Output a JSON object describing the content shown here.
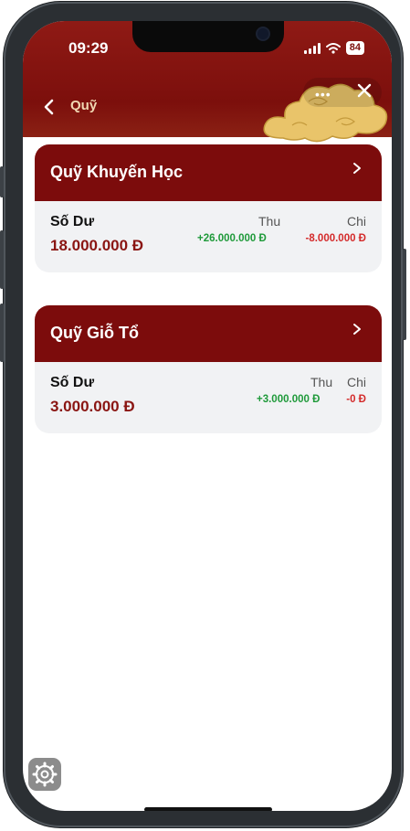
{
  "status_bar": {
    "time": "09:29",
    "battery": "84"
  },
  "header": {
    "title": "Quỹ"
  },
  "funds": [
    {
      "name": "Quỹ Khuyến Học",
      "balance_label": "Số Dư",
      "balance": "18.000.000 Đ",
      "income_label": "Thu",
      "income": "+26.000.000 Đ",
      "expense_label": "Chi",
      "expense": "-8.000.000 Đ"
    },
    {
      "name": "Quỹ Giỗ Tổ",
      "balance_label": "Số Dư",
      "balance": "3.000.000 Đ",
      "income_label": "Thu",
      "income": "+3.000.000 Đ",
      "expense_label": "Chi",
      "expense": "-0 Đ"
    }
  ],
  "icons": {
    "back": "chevron-left-icon",
    "more": "more-dots-icon",
    "close": "close-icon",
    "card_arrow": "chevron-right-icon",
    "floating": "gear-icon",
    "decoration": "cloud-decoration"
  },
  "colors": {
    "header": "#7c0f0c",
    "accent_text": "#f1d8b3",
    "income": "#1f9a3a",
    "expense": "#d42a2a",
    "balance": "#8a1512"
  }
}
